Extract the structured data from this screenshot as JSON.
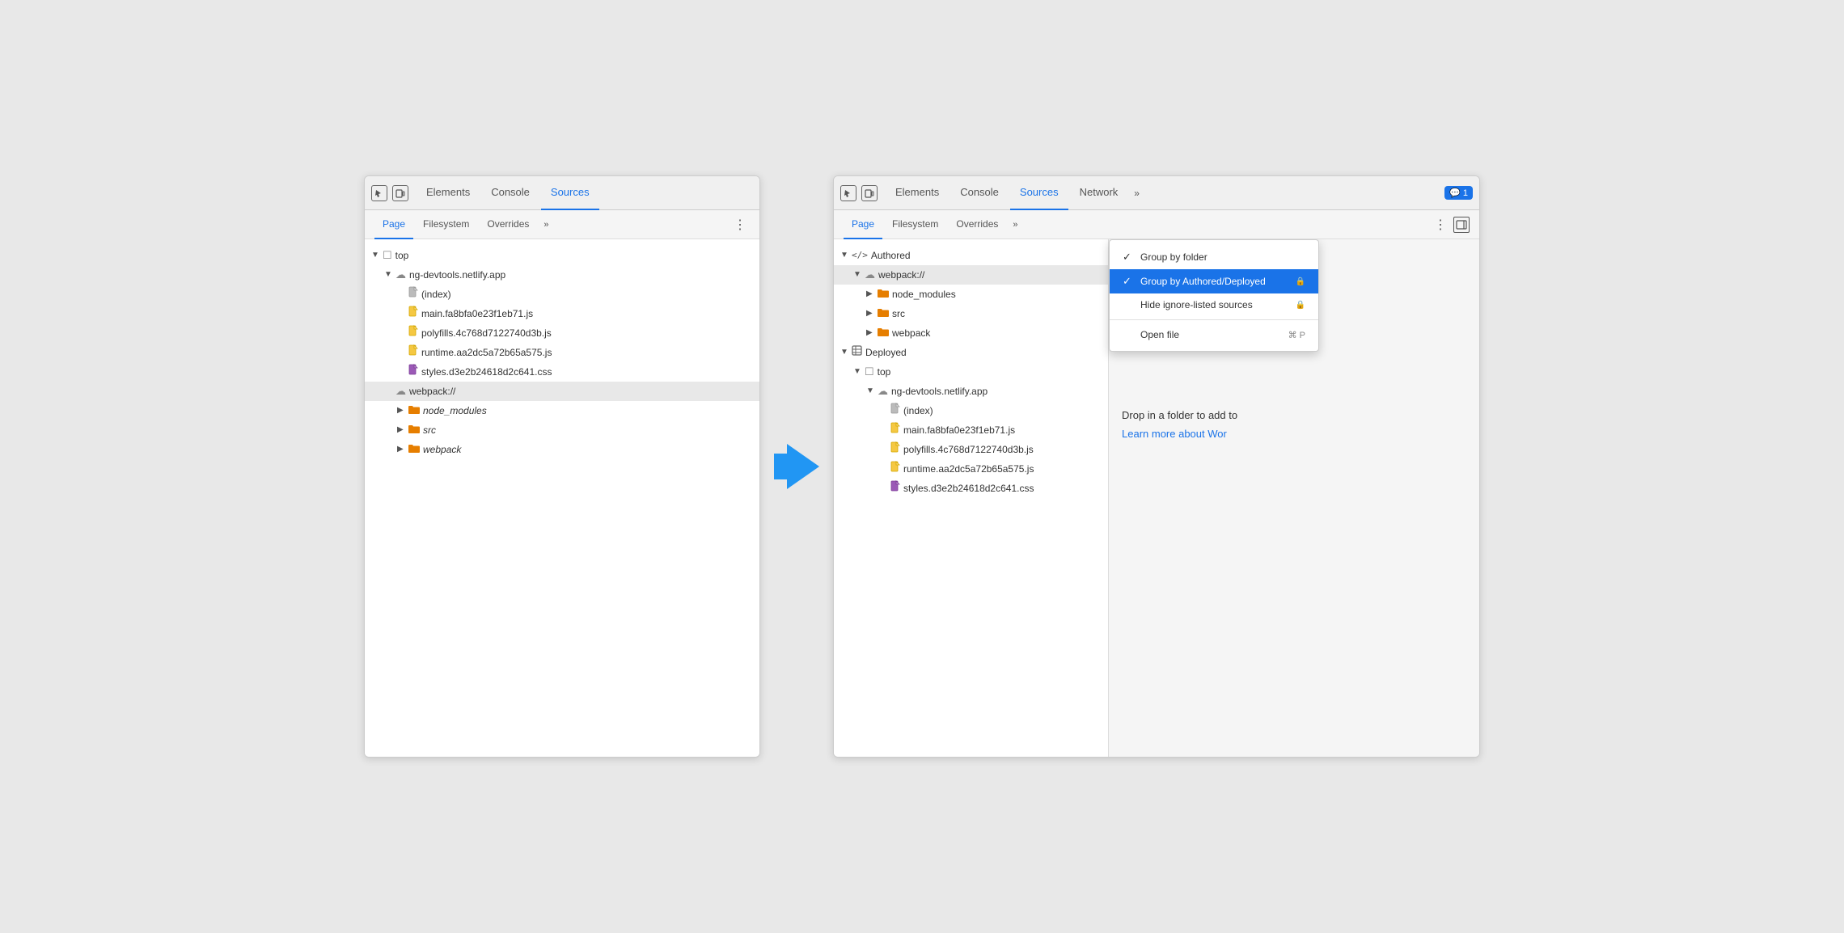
{
  "left_panel": {
    "tabs": [
      "Elements",
      "Console",
      "Sources"
    ],
    "active_tab": "Sources",
    "subtabs": [
      "Page",
      "Filesystem",
      "Overrides"
    ],
    "active_subtab": "Page",
    "tree": [
      {
        "level": 1,
        "arrow": "▼",
        "icon": "☐",
        "icon_class": "icon-box",
        "label": "top"
      },
      {
        "level": 2,
        "arrow": "▼",
        "icon": "☁",
        "icon_class": "icon-cloud",
        "label": "ng-devtools.netlify.app"
      },
      {
        "level": 3,
        "arrow": "",
        "icon": "📄",
        "icon_class": "icon-file-gray",
        "label": "(index)"
      },
      {
        "level": 3,
        "arrow": "",
        "icon": "📄",
        "icon_class": "icon-file-yellow",
        "label": "main.fa8bfa0e23f1eb71.js"
      },
      {
        "level": 3,
        "arrow": "",
        "icon": "📄",
        "icon_class": "icon-file-yellow",
        "label": "polyfills.4c768d7122740d3b.js"
      },
      {
        "level": 3,
        "arrow": "",
        "icon": "📄",
        "icon_class": "icon-file-yellow",
        "label": "runtime.aa2dc5a72b65a575.js"
      },
      {
        "level": 3,
        "arrow": "",
        "icon": "📄",
        "icon_class": "icon-file-purple",
        "label": "styles.d3e2b24618d2c641.css"
      },
      {
        "level": 2,
        "arrow": "",
        "icon": "☁",
        "icon_class": "icon-cloud",
        "label": "webpack://",
        "highlighted": true
      },
      {
        "level": 3,
        "arrow": "▶",
        "icon": "📁",
        "icon_class": "icon-folder-orange",
        "label": "node_modules",
        "italic": true
      },
      {
        "level": 3,
        "arrow": "▶",
        "icon": "📁",
        "icon_class": "icon-folder-orange",
        "label": "src",
        "italic": true
      },
      {
        "level": 3,
        "arrow": "▶",
        "icon": "📁",
        "icon_class": "icon-folder-orange",
        "label": "webpack",
        "italic": true
      }
    ]
  },
  "right_panel": {
    "tabs": [
      "Elements",
      "Console",
      "Sources",
      "Network"
    ],
    "active_tab": "Sources",
    "subtabs": [
      "Page",
      "Filesystem",
      "Overrides"
    ],
    "active_subtab": "Page",
    "notification": "1",
    "tree": [
      {
        "level": 1,
        "arrow": "▼",
        "icon": "</>",
        "icon_class": "icon-code",
        "label": "Authored"
      },
      {
        "level": 2,
        "arrow": "▼",
        "icon": "☁",
        "icon_class": "icon-cloud",
        "label": "webpack://",
        "highlighted": true
      },
      {
        "level": 3,
        "arrow": "▶",
        "icon": "📁",
        "icon_class": "icon-folder-orange",
        "label": "node_modules"
      },
      {
        "level": 3,
        "arrow": "▶",
        "icon": "📁",
        "icon_class": "icon-folder-orange",
        "label": "src"
      },
      {
        "level": 3,
        "arrow": "▶",
        "icon": "📁",
        "icon_class": "icon-folder-orange",
        "label": "webpack"
      },
      {
        "level": 1,
        "arrow": "▼",
        "icon": "📦",
        "icon_class": "icon-cube",
        "label": "Deployed"
      },
      {
        "level": 2,
        "arrow": "▼",
        "icon": "☐",
        "icon_class": "icon-box",
        "label": "top"
      },
      {
        "level": 3,
        "arrow": "▼",
        "icon": "☁",
        "icon_class": "icon-cloud",
        "label": "ng-devtools.netlify.app"
      },
      {
        "level": 4,
        "arrow": "",
        "icon": "📄",
        "icon_class": "icon-file-gray",
        "label": "(index)"
      },
      {
        "level": 4,
        "arrow": "",
        "icon": "📄",
        "icon_class": "icon-file-yellow",
        "label": "main.fa8bfa0e23f1eb71.js"
      },
      {
        "level": 4,
        "arrow": "",
        "icon": "📄",
        "icon_class": "icon-file-yellow",
        "label": "polyfills.4c768d7122740d3b.js"
      },
      {
        "level": 4,
        "arrow": "",
        "icon": "📄",
        "icon_class": "icon-file-yellow",
        "label": "runtime.aa2dc5a72b65a575.js"
      },
      {
        "level": 4,
        "arrow": "",
        "icon": "📄",
        "icon_class": "icon-file-purple",
        "label": "styles.d3e2b24618d2c641.css"
      }
    ],
    "dropdown": {
      "items": [
        {
          "label": "Group by folder",
          "checked": false,
          "shortcut": "",
          "has_lock": false
        },
        {
          "label": "Group by Authored/Deployed",
          "checked": true,
          "shortcut": "",
          "has_lock": true
        },
        {
          "label": "Hide ignore-listed sources",
          "checked": false,
          "shortcut": "",
          "has_lock": true
        }
      ],
      "divider_after": 2,
      "open_file": {
        "label": "Open file",
        "shortcut": "⌘ P"
      }
    },
    "right_area": {
      "drop_text": "Drop in a folder to add to",
      "learn_text": "Learn more about Wor"
    }
  }
}
